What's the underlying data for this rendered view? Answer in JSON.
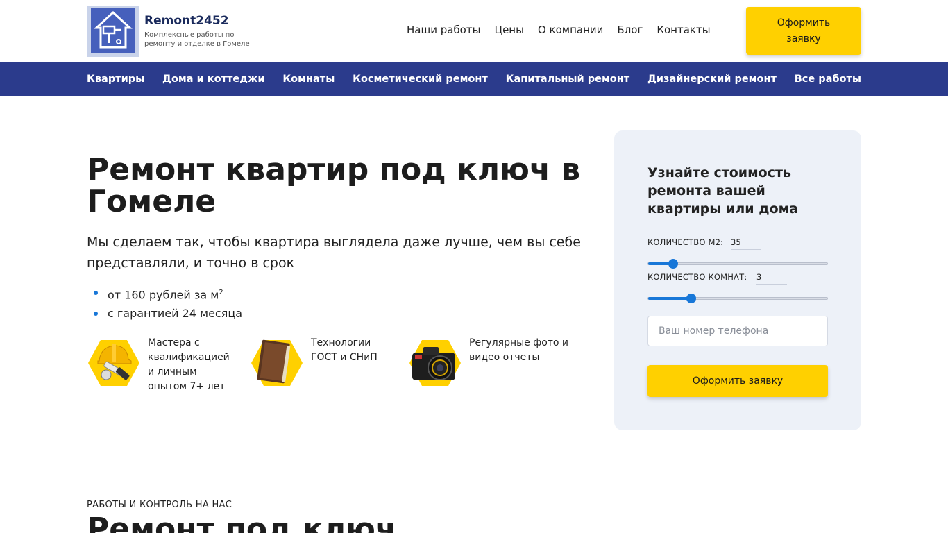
{
  "header": {
    "brand": "Remont2452",
    "tagline": "Комплексные работы по ремонту и отделке в Гомеле",
    "logo_text": "РЕМОНТ 2452",
    "nav": [
      "Наши работы",
      "Цены",
      "О компании",
      "Блог",
      "Контакты"
    ],
    "cta": "Оформить заявку"
  },
  "categories": [
    "Квартиры",
    "Дома и коттеджи",
    "Комнаты",
    "Косметический ремонт",
    "Капитальный ремонт",
    "Дизайнерский ремонт",
    "Все работы"
  ],
  "hero": {
    "title": "Ремонт квартир под ключ в Гомеле",
    "subtitle": "Мы сделаем так, чтобы квартира выглядела даже лучше, чем вы себе представляли, и точно в срок",
    "bullet_price": "от 160 рублей за м",
    "bullet_price_sup": "2",
    "bullet_guarantee": "с гарантией 24 месяца",
    "features": [
      {
        "icon": "helmet-tools-icon",
        "text": "Мастера с квалификацией и личным опытом 7+ лет"
      },
      {
        "icon": "book-icon",
        "text": "Технологии ГОСТ и СНиП"
      },
      {
        "icon": "camera-icon",
        "text": "Регулярные фото и видео отчеты"
      }
    ]
  },
  "form": {
    "title": "Узнайте стоимость ремонта вашей квартиры или дома",
    "area_label": "КОЛИЧЕСТВО М2:",
    "area_value": "35",
    "area_fraction": 0.14,
    "rooms_label": "КОЛИЧЕСТВО КОМНАТ:",
    "rooms_value": "3",
    "rooms_fraction": 0.24,
    "phone_placeholder": "Ваш номер телефона",
    "submit": "Оформить заявку"
  },
  "next_section": {
    "eyebrow": "РАБОТЫ И КОНТРОЛЬ НА НАС",
    "title": "Ремонт под ключ"
  },
  "colors": {
    "accent_yellow": "#ffd000",
    "nav_blue": "#2b3b8c",
    "slider_blue": "#1877d8",
    "card_bg": "#edf1f8"
  }
}
